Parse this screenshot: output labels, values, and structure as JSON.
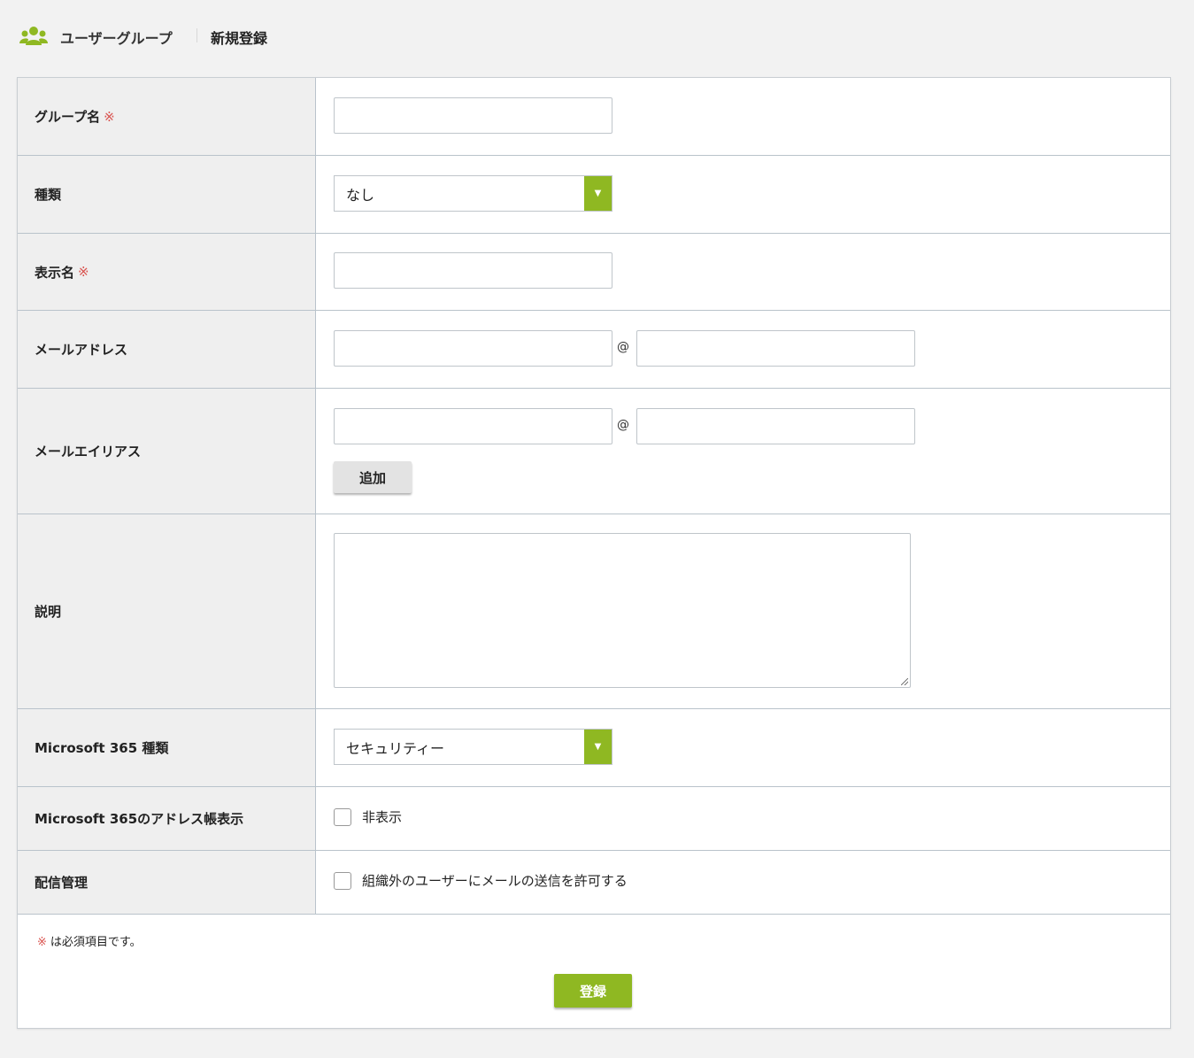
{
  "header": {
    "icon": "users-icon",
    "breadcrumb_section": "ユーザーグループ",
    "breadcrumb_page": "新規登録"
  },
  "form": {
    "required_mark": "※",
    "group_name": {
      "label": "グループ名",
      "value": ""
    },
    "type": {
      "label": "種類",
      "selected": "なし"
    },
    "display_name": {
      "label": "表示名",
      "value": ""
    },
    "email": {
      "label": "メールアドレス",
      "local": "",
      "at": "@",
      "domain": ""
    },
    "email_alias": {
      "label": "メールエイリアス",
      "local": "",
      "at": "@",
      "domain": "",
      "add_button": "追加"
    },
    "description": {
      "label": "説明",
      "value": ""
    },
    "ms365_type": {
      "label": "Microsoft 365 種類",
      "selected": "セキュリティー"
    },
    "ms365_address_book": {
      "label": "Microsoft 365のアドレス帳表示",
      "checkbox_label": "非表示",
      "checked": false
    },
    "delivery": {
      "label": "配信管理",
      "checkbox_label": "組織外のユーザーにメールの送信を許可する",
      "checked": false
    }
  },
  "footer": {
    "note_mark": "※",
    "note_text": "は必須項目です。",
    "submit_label": "登録"
  },
  "colors": {
    "accent": "#8fb822",
    "required": "#d9534f",
    "label_bg": "#efefef",
    "page_bg": "#f2f2f2"
  }
}
